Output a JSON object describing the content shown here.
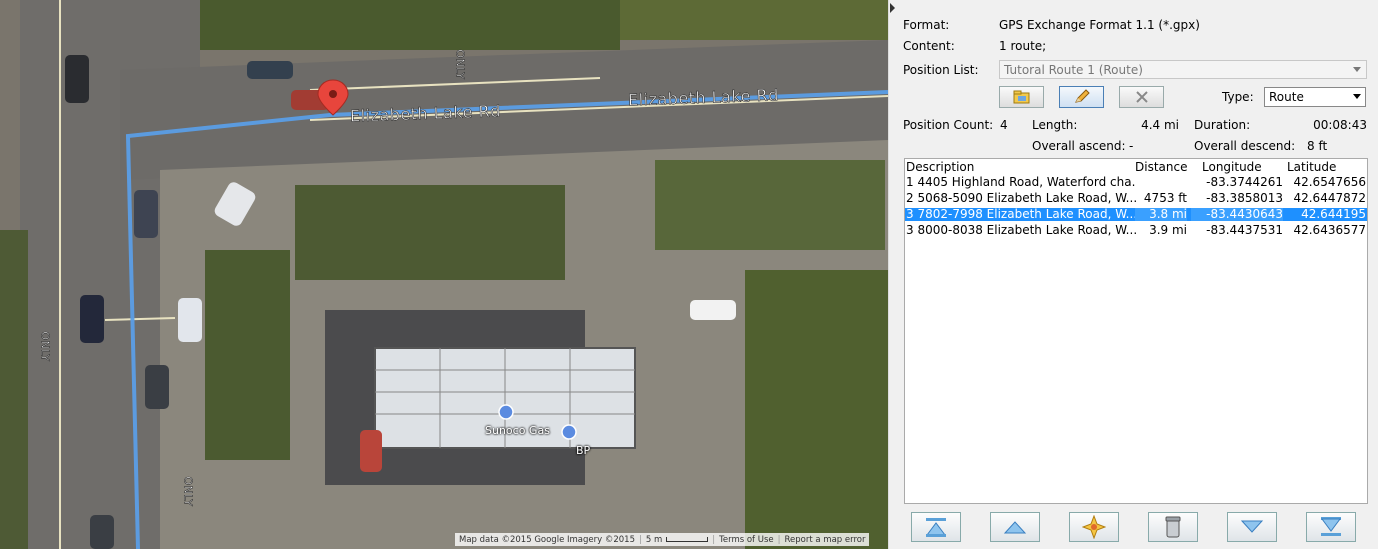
{
  "map": {
    "road_label_1": "Elizabeth Lake Rd",
    "road_label_2": "Elizabeth Lake Rd",
    "road_text_only_1": "ONLY",
    "road_text_only_2": "ONLY",
    "road_text_only_3": "ONLY",
    "poi_sunoco": "Sunoco Gas",
    "poi_bp": "BP",
    "footer": {
      "copyright": "Map data ©2015 Google Imagery ©2015",
      "scale": "5 m",
      "terms": "Terms of Use",
      "report": "Report a map error"
    },
    "route_color": "#5b9ee6",
    "marker_color": "#e8453c"
  },
  "panel": {
    "format_label": "Format:",
    "format_value": "GPS Exchange Format 1.1 (*.gpx)",
    "content_label": "Content:",
    "content_value": "1 route;",
    "position_list_label": "Position List:",
    "position_list_value": "Tutoral Route 1 (Route)",
    "type_label": "Type:",
    "type_value": "Route",
    "position_count_label": "Position Count:",
    "position_count_value": "4",
    "length_label": "Length:",
    "length_value": "4.4 mi",
    "duration_label": "Duration:",
    "duration_value": "00:08:43",
    "ascend_label": "Overall ascend:",
    "ascend_value": "-",
    "descend_label": "Overall descend:",
    "descend_value": "8 ft"
  },
  "table": {
    "headers": [
      "Description",
      "Distance",
      "Longitude",
      "Latitude"
    ],
    "rows": [
      {
        "desc": "1 4405 Highland Road, Waterford cha...",
        "dist": "",
        "lon": "-83.3744261",
        "lat": "42.6547656"
      },
      {
        "desc": "2 5068-5090 Elizabeth Lake Road, W...",
        "dist": "4753 ft",
        "lon": "-83.3858013",
        "lat": "42.6447872"
      },
      {
        "desc": "3 7802-7998 Elizabeth Lake Road, W...",
        "dist": "3.8 mi",
        "lon": "-83.4430643",
        "lat": "42.644195"
      },
      {
        "desc": "3 8000-8038 Elizabeth Lake Road, W...",
        "dist": "3.9 mi",
        "lon": "-83.4437531",
        "lat": "42.6436577"
      }
    ],
    "selected_index": 2
  },
  "toolbar_icons": [
    "open-folder-icon",
    "edit-pencil-icon",
    "delete-x-icon"
  ],
  "nav_icons": [
    "move-to-top-icon",
    "move-up-icon",
    "add-point-icon",
    "delete-trash-icon",
    "move-down-icon",
    "move-to-bottom-icon"
  ]
}
